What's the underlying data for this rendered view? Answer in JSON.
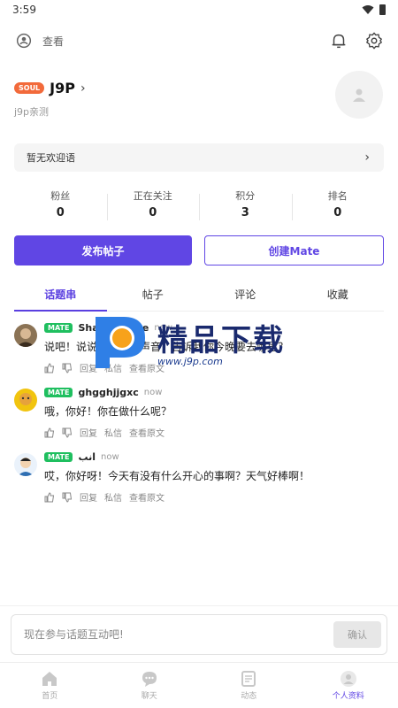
{
  "status_bar": {
    "time": "3:59"
  },
  "top_bar": {
    "visitors_label": "查看"
  },
  "profile": {
    "badge": "SOUL",
    "username": "J9P",
    "subtitle": "j9p亲测",
    "welcome": "暂无欢迎语"
  },
  "stats": [
    {
      "label": "粉丝",
      "value": "0"
    },
    {
      "label": "正在关注",
      "value": "0"
    },
    {
      "label": "积分",
      "value": "3"
    },
    {
      "label": "排名",
      "value": "0"
    }
  ],
  "actions": {
    "post_label": "发布帖子",
    "create_mate_label": "创建Mate"
  },
  "tabs": [
    "话题串",
    "帖子",
    "评论",
    "收藏"
  ],
  "comments": [
    {
      "badge": "MATE",
      "name": "Shakespeare",
      "time": "now",
      "text": "说吧！说说你心中的声音，告诉我你今晚要去哪里？",
      "reply": "回复",
      "dm": "私信",
      "view": "查看原文"
    },
    {
      "badge": "MATE",
      "name": "ghgghjjgxc",
      "time": "now",
      "text": "哦，你好！你在做什么呢？",
      "reply": "回复",
      "dm": "私信",
      "view": "查看原文"
    },
    {
      "badge": "MATE",
      "name": "انب",
      "time": "now",
      "text": "哎，你好呀！今天有没有什么开心的事啊？天气好棒啊！",
      "reply": "回复",
      "dm": "私信",
      "view": "查看原文"
    }
  ],
  "watermark": {
    "title": "精品下载",
    "url": "www.j9p.com"
  },
  "input": {
    "placeholder": "现在参与话题互动吧!",
    "confirm_label": "确认"
  },
  "nav": [
    {
      "label": "首页",
      "icon": "home-icon"
    },
    {
      "label": "聊天",
      "icon": "chat-icon"
    },
    {
      "label": "动态",
      "icon": "feed-icon"
    },
    {
      "label": "个人资料",
      "icon": "profile-icon"
    }
  ],
  "colors": {
    "accent": "#6046e4",
    "soul_badge": "#f26a3b",
    "mate_badge": "#1fbf5f"
  }
}
